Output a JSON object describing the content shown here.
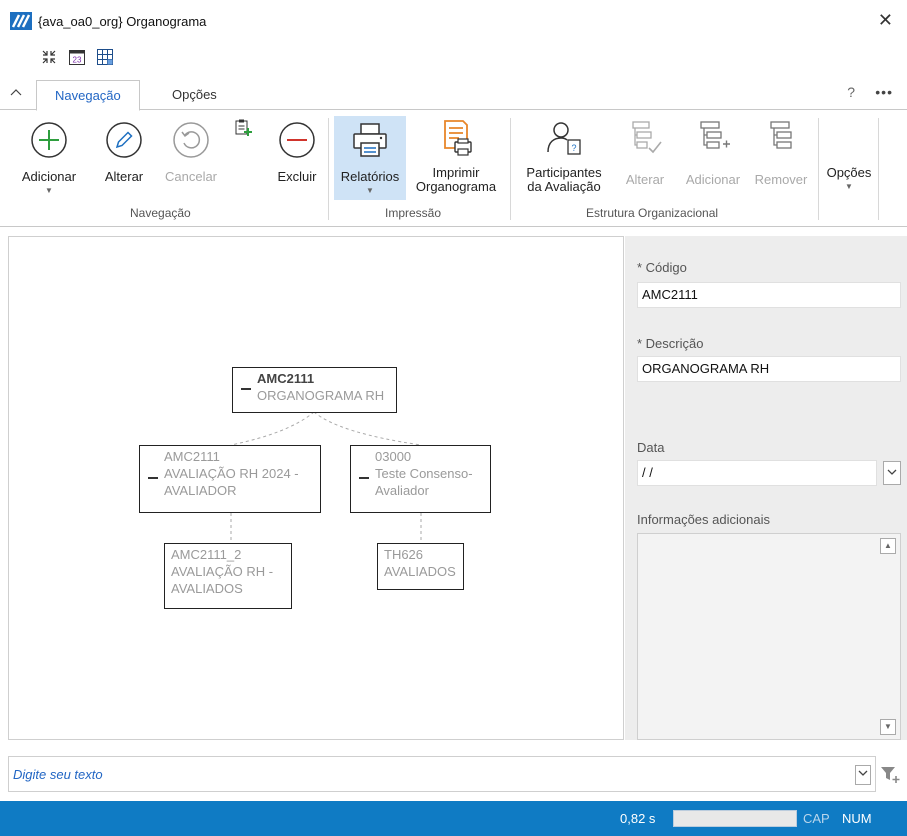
{
  "window": {
    "title": "{ava_oa0_org} Organograma",
    "close_glyph": "✕"
  },
  "tabs": [
    {
      "label": "Navegação",
      "active": true
    },
    {
      "label": "Opções",
      "active": false
    }
  ],
  "tabbar": {
    "help": "?",
    "more": "•••"
  },
  "ribbon": {
    "nav": {
      "add": "Adicionar",
      "edit": "Alterar",
      "cancel": "Cancelar",
      "delete": "Excluir",
      "group": "Navegação"
    },
    "print": {
      "reports": "Relatórios",
      "print_line1": "Imprimir",
      "print_line2": "Organograma",
      "group": "Impressão"
    },
    "struct": {
      "participants_line1": "Participantes",
      "participants_line2": "da Avaliação",
      "edit": "Alterar",
      "add": "Adicionar",
      "remove": "Remover",
      "group": "Estrutura Organizacional"
    },
    "options": "Opções"
  },
  "org": {
    "root": {
      "code": "AMC2111",
      "desc": "ORGANOGRAMA RH"
    },
    "child1": {
      "code": "AMC2111",
      "desc1": "AVALIAÇÃO RH 2024 -",
      "desc2": "AVALIADOR"
    },
    "child2": {
      "code": "03000",
      "desc1": "Teste Consenso-",
      "desc2": "Avaliador"
    },
    "leaf1": {
      "code": "AMC2111_2",
      "desc1": "AVALIAÇÃO RH -",
      "desc2": "AVALIADOS"
    },
    "leaf2": {
      "code": "TH626",
      "desc1": "AVALIADOS"
    }
  },
  "form": {
    "code_label": "* Código",
    "code_value": "AMC2111",
    "desc_label": "* Descrição",
    "desc_value": "ORGANOGRAMA RH",
    "date_label": "Data",
    "date_value": " / /",
    "info_label": "Informações adicionais"
  },
  "search": {
    "placeholder": "Digite seu texto"
  },
  "status": {
    "time": "0,82 s",
    "progress": 0,
    "cap": "CAP",
    "num": "NUM"
  },
  "colors": {
    "accent": "#2266c4",
    "status_bg": "#0f7bc4",
    "add_green": "#2e9e3e",
    "delete_red": "#d0342c",
    "print_orange": "#e8862a"
  }
}
